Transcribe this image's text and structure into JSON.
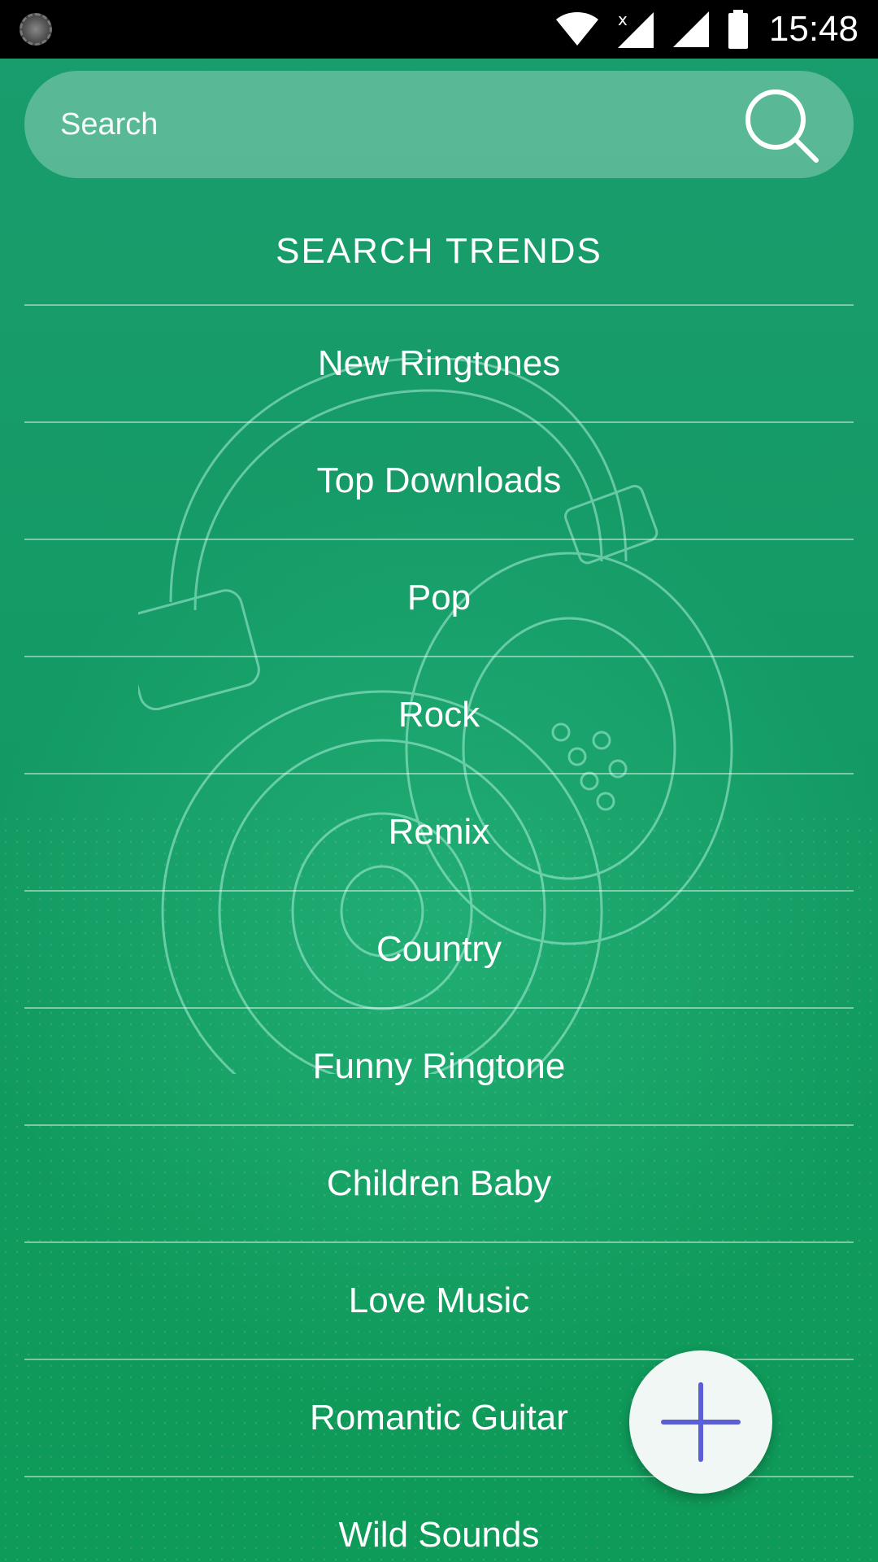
{
  "status_bar": {
    "time": "15:48",
    "icons": [
      "app-notification-icon",
      "wifi-icon",
      "signal-no-data-icon",
      "signal-icon",
      "battery-icon"
    ]
  },
  "search": {
    "placeholder": "Search",
    "value": ""
  },
  "trends": {
    "title": "SEARCH TRENDS",
    "items": [
      "New Ringtones",
      "Top Downloads",
      "Pop",
      "Rock",
      "Remix",
      "Country",
      "Funny Ringtone",
      "Children Baby",
      "Love Music",
      "Romantic Guitar",
      "Wild Sounds"
    ]
  },
  "fab": {
    "icon": "plus-icon"
  },
  "colors": {
    "background": "#139a63",
    "accent_plus": "#5a5fd8",
    "text": "#ffffff"
  }
}
